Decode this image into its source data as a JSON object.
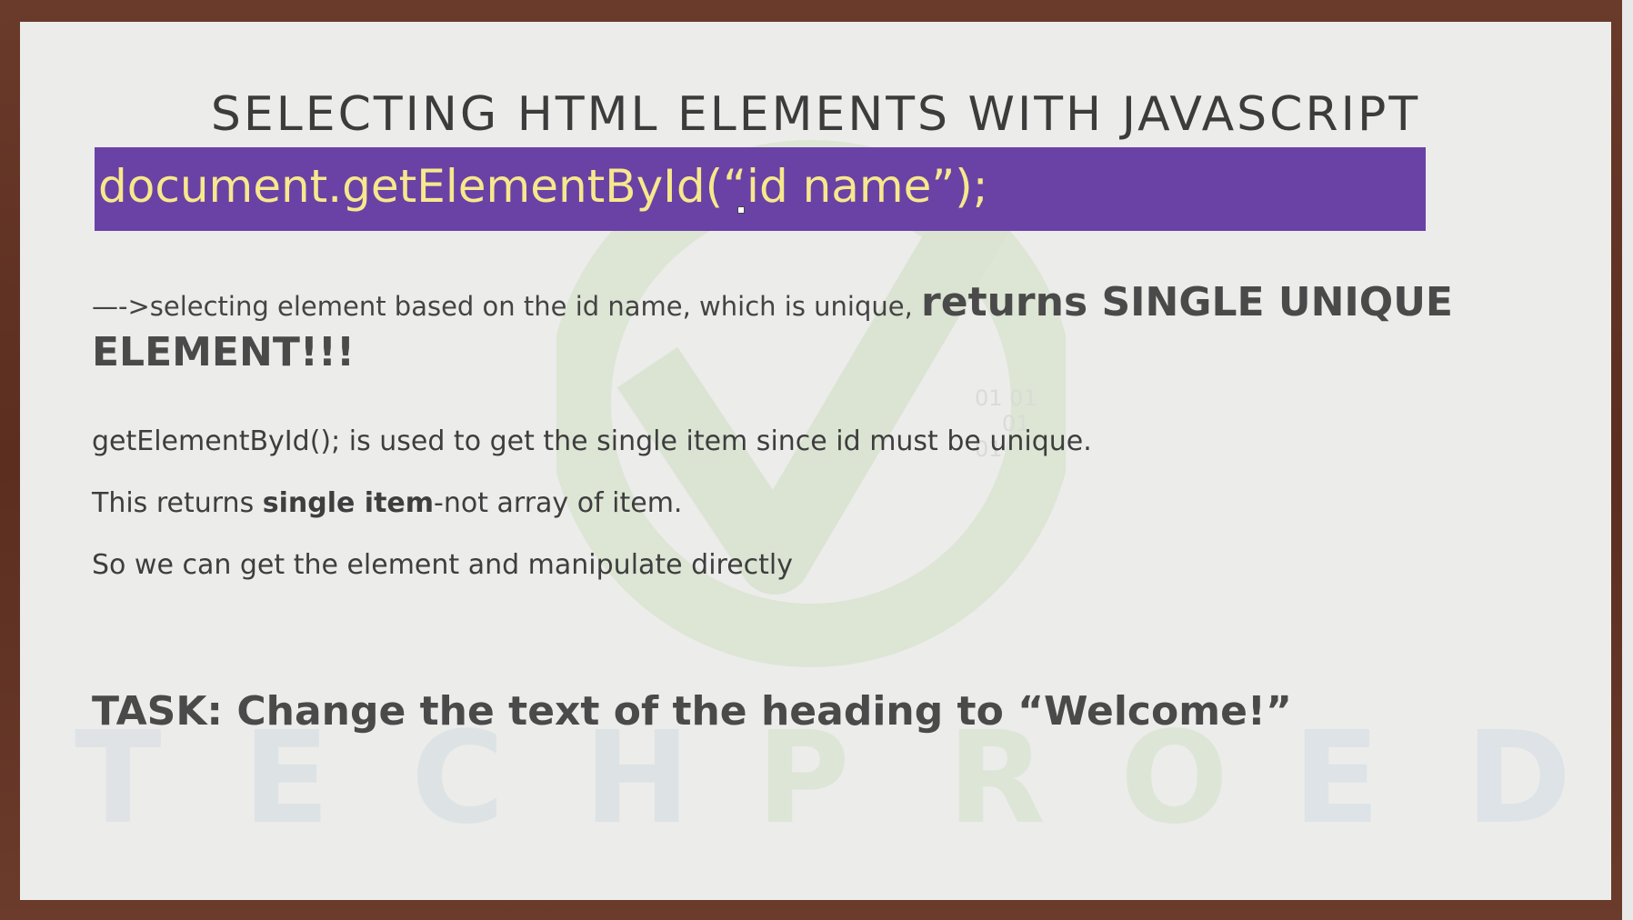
{
  "slide": {
    "title": "SELECTING HTML ELEMENTS WITH JAVASCRIPT",
    "code": "document.getElementById(“id name”);",
    "line1_prefix": "—->selecting element based on the id name, which is unique, ",
    "line1_emphasis": "returns SINGLE UNIQUE ELEMENT!!!",
    "para1": "getElementById(); is used to get the single item since id must be unique.",
    "para2_prefix": "This returns ",
    "para2_bold": "single item",
    "para2_suffix": "-not array of item.",
    "para3": "So we can get the element and manipulate directly",
    "task": "TASK: Change the text of the heading to “Welcome!”"
  },
  "watermark": {
    "brand_letters": [
      "T",
      "E",
      "C",
      "H",
      "P",
      "R",
      "O",
      "E",
      "D"
    ],
    "code_lines": [
      "01  01",
      "01",
      "01"
    ],
    "icon": "checkmark-icon"
  },
  "colors": {
    "code_bar": "#6a42a6",
    "code_text": "#f7e88c",
    "slide_bg": "#ececeb",
    "frame": "#5b2e20"
  }
}
